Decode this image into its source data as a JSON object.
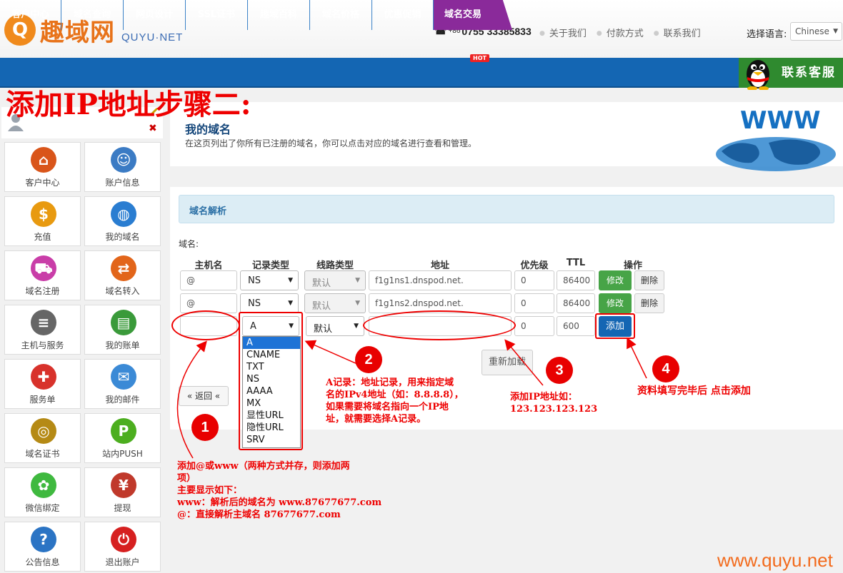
{
  "header": {
    "logo_mark": "Q",
    "logo_cn": "趣域网",
    "logo_en": "QUYU·NET",
    "phone_prefix": "+86",
    "phone": "0755 33385833",
    "links": [
      "关于我们",
      "付款方式",
      "联系我们"
    ],
    "lang_label": "选择语言:",
    "lang_value": "Chinese"
  },
  "nav": {
    "items": [
      "客户中心",
      "域名查询",
      "网页设计",
      "SSL证书",
      "趣域百科",
      "域名价格",
      "优惠促销",
      "域名交易"
    ],
    "hot_badge": "HOT",
    "service": "联系客服"
  },
  "annotation_title": "添加IP地址步骤二:",
  "sidebar": {
    "tiles": [
      {
        "label": "客户中心",
        "icon": "home-icon"
      },
      {
        "label": "账户信息",
        "icon": "user-edit-icon"
      },
      {
        "label": "充值",
        "icon": "coins-icon"
      },
      {
        "label": "我的域名",
        "icon": "globe-icon"
      },
      {
        "label": "域名注册",
        "icon": "cart-icon"
      },
      {
        "label": "域名转入",
        "icon": "transfer-icon"
      },
      {
        "label": "主机与服务",
        "icon": "server-icon"
      },
      {
        "label": "我的账单",
        "icon": "bill-icon"
      },
      {
        "label": "服务单",
        "icon": "lifebuoy-icon"
      },
      {
        "label": "我的邮件",
        "icon": "mail-icon"
      },
      {
        "label": "域名证书",
        "icon": "icann-icon"
      },
      {
        "label": "站内PUSH",
        "icon": "push-icon"
      },
      {
        "label": "微信绑定",
        "icon": "wechat-icon"
      },
      {
        "label": "提现",
        "icon": "cash-icon"
      },
      {
        "label": "公告信息",
        "icon": "question-icon"
      },
      {
        "label": "退出账户",
        "icon": "power-icon"
      }
    ]
  },
  "main": {
    "title": "我的域名",
    "description": "在这页列出了你所有已注册的域名，你可以点击对应的域名进行查看和管理。",
    "globe_text": "WWW",
    "section_title": "域名解析",
    "domain_label": "域名:",
    "columns": [
      "主机名",
      "记录类型",
      "线路类型",
      "地址",
      "优先级",
      "TTL",
      "操作"
    ],
    "rows": [
      {
        "host": "@",
        "type": "NS",
        "line": "默认",
        "value": "f1g1ns1.dnspod.net.",
        "mx": "0",
        "ttl": "86400",
        "edit": "修改",
        "delete": "删除"
      },
      {
        "host": "@",
        "type": "NS",
        "line": "默认",
        "value": "f1g1ns2.dnspod.net.",
        "mx": "0",
        "ttl": "86400",
        "edit": "修改",
        "delete": "删除"
      }
    ],
    "new_row": {
      "host": "",
      "type": "A",
      "line": "默认",
      "value": "",
      "mx": "0",
      "ttl": "600",
      "add": "添加"
    },
    "type_options": [
      "A",
      "CNAME",
      "TXT",
      "NS",
      "AAAA",
      "MX",
      "显性URL",
      "隐性URL",
      "SRV"
    ],
    "reload": "重新加载",
    "back": "« 返回 «"
  },
  "notes": {
    "n1": "1",
    "n2": "2",
    "n3": "3",
    "n4": "4",
    "note1_lines": [
      "添加@或www（两种方式并存，则添加两",
      "项）",
      "主要显示如下：",
      "www：解析后的域名为 www.87677677.com",
      "@：直接解析主域名 87677677.com"
    ],
    "note2_lines": [
      "A记录：地址记录，用来指定域",
      "名的IPv4地址（如：8.8.8.8），",
      "如果需要将域名指向一个IP地",
      "址，就需要选择A记录。"
    ],
    "note3_lines": [
      "添加IP地址如：",
      "123.123.123.123"
    ],
    "note4": "资料填写完毕后 点击添加"
  },
  "watermark": "www.quyu.net"
}
